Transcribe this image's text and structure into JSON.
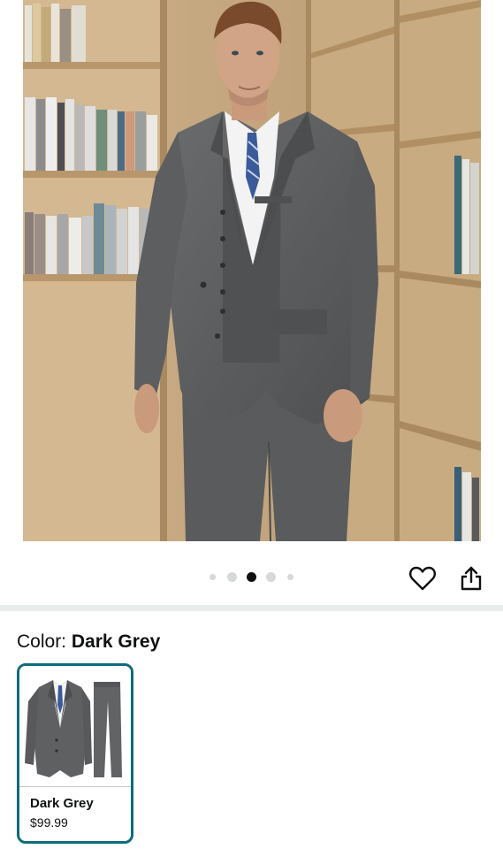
{
  "product": {
    "color_label": "Color:",
    "selected_color": "Dark Grey",
    "colors": [
      {
        "name": "Dark Grey",
        "price": "$99.99",
        "selected": true
      }
    ]
  },
  "carousel": {
    "total_images": 5,
    "active_index": 2
  },
  "actions": {
    "wishlist_icon": "heart-icon",
    "share_icon": "share-icon"
  },
  "theme": {
    "selected_border": "#0f6b7b",
    "suit_color": "#5f6062",
    "text_color": "#0f1111"
  }
}
